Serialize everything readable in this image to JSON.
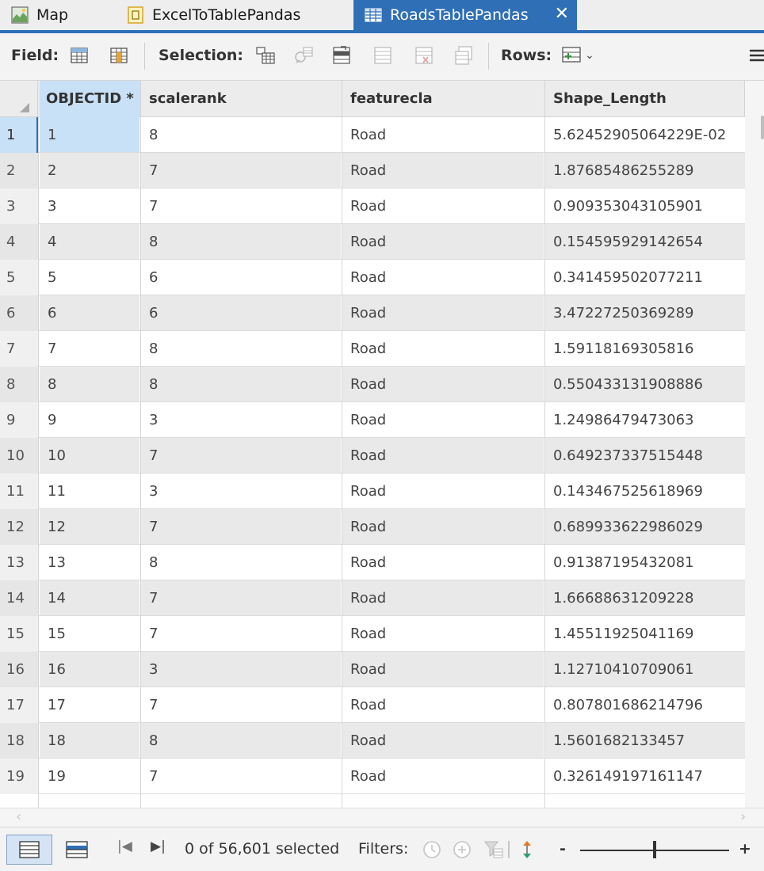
{
  "tabs": [
    {
      "label": "Map",
      "icon": "map-icon",
      "active": false
    },
    {
      "label": "ExcelToTablePandas",
      "icon": "excel-table-icon",
      "active": false
    },
    {
      "label": "RoadsTablePandas",
      "icon": "table-grid-icon",
      "active": true
    }
  ],
  "toolbar": {
    "field_label": "Field:",
    "selection_label": "Selection:",
    "rows_label": "Rows:",
    "menu_icon": "hamburger-menu-icon"
  },
  "table": {
    "columns": [
      "OBJECTID *",
      "scalerank",
      "featurecla",
      "Shape_Length"
    ],
    "rows": [
      {
        "num": "1",
        "objectid": "1",
        "scalerank": "8",
        "featurecla": "Road",
        "shape_length": "5.62452905064229E-02"
      },
      {
        "num": "2",
        "objectid": "2",
        "scalerank": "7",
        "featurecla": "Road",
        "shape_length": "1.87685486255289"
      },
      {
        "num": "3",
        "objectid": "3",
        "scalerank": "7",
        "featurecla": "Road",
        "shape_length": "0.909353043105901"
      },
      {
        "num": "4",
        "objectid": "4",
        "scalerank": "8",
        "featurecla": "Road",
        "shape_length": "0.154595929142654"
      },
      {
        "num": "5",
        "objectid": "5",
        "scalerank": "6",
        "featurecla": "Road",
        "shape_length": "0.341459502077211"
      },
      {
        "num": "6",
        "objectid": "6",
        "scalerank": "6",
        "featurecla": "Road",
        "shape_length": "3.47227250369289"
      },
      {
        "num": "7",
        "objectid": "7",
        "scalerank": "8",
        "featurecla": "Road",
        "shape_length": "1.59118169305816"
      },
      {
        "num": "8",
        "objectid": "8",
        "scalerank": "8",
        "featurecla": "Road",
        "shape_length": "0.550433131908886"
      },
      {
        "num": "9",
        "objectid": "9",
        "scalerank": "3",
        "featurecla": "Road",
        "shape_length": "1.24986479473063"
      },
      {
        "num": "10",
        "objectid": "10",
        "scalerank": "7",
        "featurecla": "Road",
        "shape_length": "0.649237337515448"
      },
      {
        "num": "11",
        "objectid": "11",
        "scalerank": "3",
        "featurecla": "Road",
        "shape_length": "0.143467525618969"
      },
      {
        "num": "12",
        "objectid": "12",
        "scalerank": "7",
        "featurecla": "Road",
        "shape_length": "0.689933622986029"
      },
      {
        "num": "13",
        "objectid": "13",
        "scalerank": "8",
        "featurecla": "Road",
        "shape_length": "0.91387195432081"
      },
      {
        "num": "14",
        "objectid": "14",
        "scalerank": "7",
        "featurecla": "Road",
        "shape_length": "1.66688631209228"
      },
      {
        "num": "15",
        "objectid": "15",
        "scalerank": "7",
        "featurecla": "Road",
        "shape_length": "1.45511925041169"
      },
      {
        "num": "16",
        "objectid": "16",
        "scalerank": "3",
        "featurecla": "Road",
        "shape_length": "1.12710410709061"
      },
      {
        "num": "17",
        "objectid": "17",
        "scalerank": "7",
        "featurecla": "Road",
        "shape_length": "0.807801686214796"
      },
      {
        "num": "18",
        "objectid": "18",
        "scalerank": "8",
        "featurecla": "Road",
        "shape_length": "1.5601682133457"
      },
      {
        "num": "19",
        "objectid": "19",
        "scalerank": "7",
        "featurecla": "Road",
        "shape_length": "0.326149197161147"
      }
    ]
  },
  "status": {
    "selected_text": "0 of 56,601 selected",
    "filters_label": "Filters:",
    "zoom_minus": "-",
    "zoom_plus": "+",
    "zoom_level": 0.49
  },
  "colors": {
    "accent": "#2f6fb5",
    "selection": "#c9e1f6",
    "header_bg": "#ececec"
  }
}
